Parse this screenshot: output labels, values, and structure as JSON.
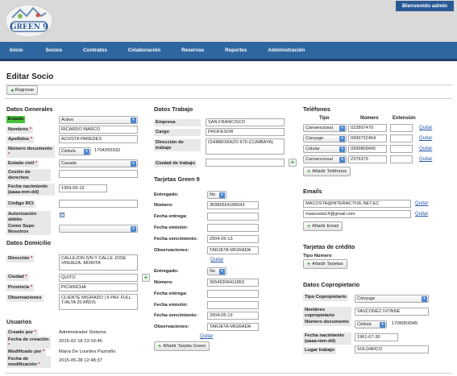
{
  "header": {
    "welcome": "Bienvenido admin",
    "logo_text": "GREEN 9"
  },
  "nav": [
    "Inicio",
    "Socios",
    "Contratos",
    "Colaboración",
    "Reservas",
    "Reportes",
    "Administración"
  ],
  "page": {
    "title": "Editar Socio",
    "back_label": "Regresar"
  },
  "generales": {
    "title": "Datos Generales",
    "estado_label": "Estado",
    "estado_value": "Activo",
    "nombres_label": "Nombres",
    "nombres_value": "RICARDO MARCO",
    "apellidos_label": "Apellidos",
    "apellidos_value": "ACOSTA PAREDES",
    "numdoc_label": "Número documento",
    "numdoc_tipo": "Cédula",
    "numdoc_value": "1704255932",
    "estadocivil_label": "Estado civil",
    "estadocivil_value": "Casado",
    "cesion_label": "Cesión de derechos",
    "fechanac_label": "Fecha nacimiento (aaaa-mm-dd)",
    "fechanac_value": "1959-05-16",
    "rci_label": "Código RCI",
    "autdeb_label": "Autorización débito",
    "comosupo_label": "Como Supo Nosotros"
  },
  "domicilio": {
    "title": "Datos Domicilio",
    "direccion_label": "Dirección",
    "direccion_value": "CALLEJON S/N Y CALLE JOSE VINUEZA. MORITA",
    "ciudad_label": "Ciudad",
    "ciudad_value": "QUITO",
    "provincia_label": "Provincia",
    "provincia_value": "PICHINCHA",
    "obs_label": "Observaciones",
    "obs_value": "CLIENTE MIGRADO | 6 PAX FULL T/ALTA 20 AÑOS"
  },
  "usuarios": {
    "title": "Usuarios",
    "creado_label": "Creado por",
    "creado_value": "Administrador Sistema",
    "fcreacion_label": "Fecha de creación",
    "fcreacion_value": "2015-02-18 23:19:46",
    "modificado_label": "Modificado por",
    "modificado_value": "María De Lourdes Pazmiño",
    "fmod_label": "Fecha de modificación",
    "fmod_value": "2015-05-28 12:48:37"
  },
  "trabajo": {
    "title": "Datos Trabajo",
    "empresa_label": "Empresa",
    "empresa_value": "SAN FRANCISCO",
    "cargo_label": "Cargo",
    "cargo_value": "PROFESOR",
    "dir_label": "Dirección de trabajo",
    "dir_value": "CHIMBORAZO 670 (CUMBAYA)",
    "ciudad_label": "Ciudad de trabajo"
  },
  "tarjetas": {
    "title": "Tarjetas Green 9",
    "entregado_label": "Entregado:",
    "numero_label": "Número:",
    "fentrega_label": "Fecha entrega:",
    "femision_label": "Fecha emisión:",
    "fvenc_label": "Fecha vencimiento:",
    "obs_label": "Observaciones:",
    "cards": [
      {
        "entregado": "No",
        "numero": "36980554180043",
        "fvenc": "2004-05-13",
        "obs": "TARJETA MIGRADA"
      },
      {
        "entregado": "No",
        "numero": "36545306411853",
        "fvenc": "2004-05-13",
        "obs": "TARJETA MIGRADA"
      }
    ],
    "quitar": "Quitar",
    "add_label": "Añadir Tarjeta Green"
  },
  "telefonos": {
    "title": "Teléfonos",
    "headers": [
      "Tipo",
      "Número",
      "Extensión"
    ],
    "rows": [
      {
        "tipo": "Convencional",
        "numero": "022897470"
      },
      {
        "tipo": "Cónyuge",
        "numero": "0999722464"
      },
      {
        "tipo": "Celular",
        "numero": "0999809495"
      },
      {
        "tipo": "Convencional",
        "numero": "2376379"
      }
    ],
    "quitar": "Quitar",
    "add_label": "Añadir Teléfonos"
  },
  "emails": {
    "title": "Emails",
    "rows": [
      "MACOSTA@INTERACTIVE.NET.EC",
      "maacosta14@gmail.com"
    ],
    "quitar": "Quitar",
    "add_label": "Añadir Email"
  },
  "credito": {
    "title": "Tarjetas de crédito",
    "tipo_label": "Tipo Número",
    "add_label": "Añadir Tarjetas"
  },
  "copropietario": {
    "title": "Datos Copropietario",
    "tipo_label": "Tipo Copropietario",
    "tipo_value": "Cónyuge",
    "nombres_label": "Nombres copropietario",
    "nombres_value": "VASCONEZ IVONNE",
    "numdoc_label": "Número documento",
    "numdoc_tipo": "Cédula",
    "numdoc_value": "1706959945",
    "fechanac_label": "Fecha nacimiento (aaaa-mm-dd)",
    "fechanac_value": "1961-07-30",
    "trabajo_label": "Lugar trabajo",
    "trabajo_value": "SOLDARCO"
  },
  "colors": {
    "nav": "#2f669f",
    "welcome": "#2a5a96",
    "estado_badge": "#49c33d",
    "link": "#2457a8"
  }
}
